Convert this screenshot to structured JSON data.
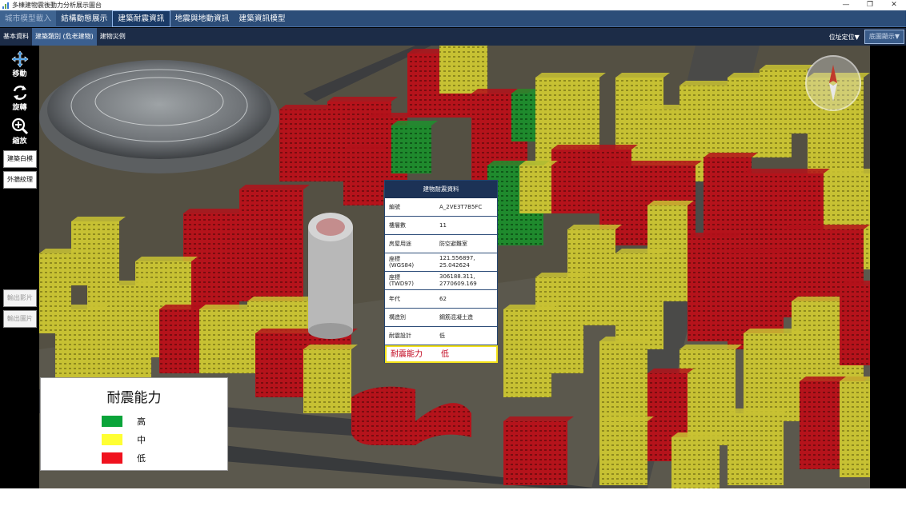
{
  "window": {
    "title": "多棟建物震後動力分析展示圖台",
    "controls": [
      "—",
      "❐",
      "✕"
    ]
  },
  "menu": [
    {
      "label": "城市模型載入",
      "state": "disabled"
    },
    {
      "label": "結構動態展示",
      "state": "normal"
    },
    {
      "label": "建築耐震資訊",
      "state": "active"
    },
    {
      "label": "地震與地動資訊",
      "state": "normal"
    },
    {
      "label": "建築資訊模型",
      "state": "normal"
    }
  ],
  "subtabs": [
    {
      "label": "基本資料",
      "active": false
    },
    {
      "label": "建築類別 (危老建物)",
      "active": true
    },
    {
      "label": "建物災例",
      "active": false
    }
  ],
  "subbar_right": {
    "locate_label": "位址定位▼",
    "layer_label": "底圖顯示▼"
  },
  "tools": {
    "move_label": "移動",
    "rotate_label": "旋轉",
    "zoom_label": "縮放",
    "white_model_label": "建築白模",
    "texture_label": "外牆紋理",
    "export_video_label": "輸出影片",
    "export_image_label": "輸出圖片"
  },
  "info_panel": {
    "title": "建物耐震資料",
    "rows": [
      {
        "key": "編號",
        "value": "A_2VE3T7B5FC"
      },
      {
        "key": "樓層數",
        "value": "11"
      },
      {
        "key": "房屋用途",
        "value": "防空避難室"
      },
      {
        "key": "座標\n(WGS84)",
        "value": "121.556897,\n25.042624"
      },
      {
        "key": "座標\n(TWD97)",
        "value": "306188.311,\n2770609.169"
      },
      {
        "key": "年代",
        "value": "62"
      },
      {
        "key": "構造別",
        "value": "鋼筋混凝土造"
      },
      {
        "key": "耐震設計",
        "value": "低"
      }
    ],
    "highlight": {
      "key": "耐震能力",
      "value": "低"
    }
  },
  "legend": {
    "title": "耐震能力",
    "items": [
      {
        "label": "高",
        "color": "#0aa43a"
      },
      {
        "label": "中",
        "color": "#ffff33"
      },
      {
        "label": "低",
        "color": "#f0121e"
      }
    ]
  },
  "colors": {
    "high": "#1f8f2e",
    "medium": "#c9c232",
    "low": "#b3121a",
    "menu_bg": "#2c4d78",
    "subbar_bg": "#1c2c47"
  }
}
